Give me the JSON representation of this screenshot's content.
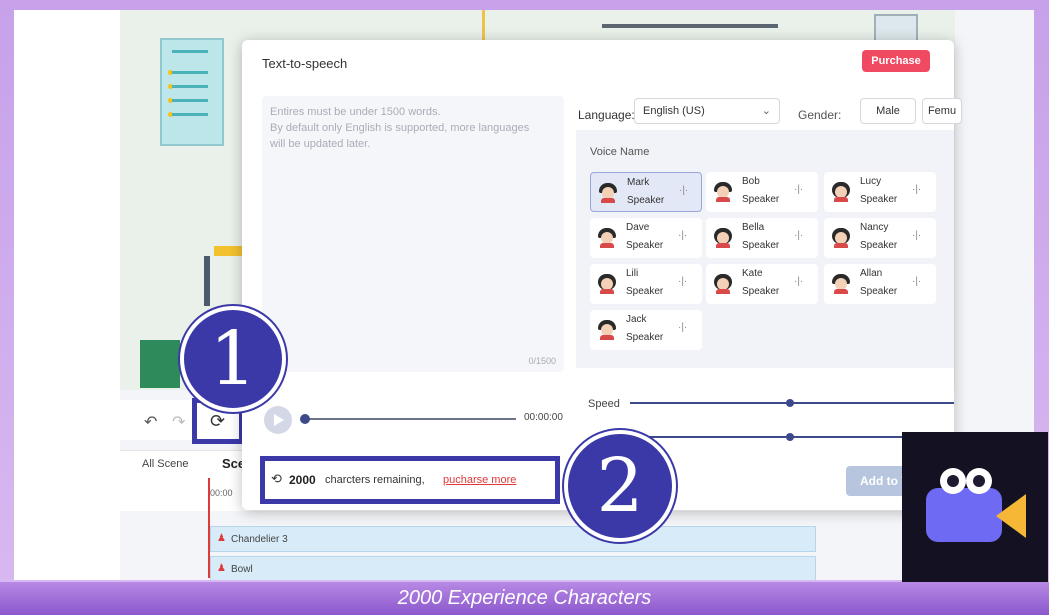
{
  "dialog": {
    "title": "Text-to-speech",
    "purchase_label": "Purchase",
    "textarea": {
      "line1": "Entires must be under 1500 words.",
      "line2": "By default only English is supported, more languages",
      "line3": "will be updated later.",
      "char_count": "0/1500"
    },
    "language": {
      "label": "Language:",
      "selected": "English (US)"
    },
    "gender": {
      "label": "Gender:",
      "options": [
        "Male",
        "Femu"
      ]
    },
    "voice_header": "Voice Name",
    "voices": [
      {
        "name": "Mark",
        "role": "Speaker",
        "selected": true
      },
      {
        "name": "Bob",
        "role": "Speaker",
        "selected": false
      },
      {
        "name": "Lucy",
        "role": "Speaker",
        "selected": false
      },
      {
        "name": "Dave",
        "role": "Speaker",
        "selected": false
      },
      {
        "name": "Bella",
        "role": "Speaker",
        "selected": false
      },
      {
        "name": "Nancy",
        "role": "Speaker",
        "selected": false
      },
      {
        "name": "Lili",
        "role": "Speaker",
        "selected": false
      },
      {
        "name": "Kate",
        "role": "Speaker",
        "selected": false
      },
      {
        "name": "Allan",
        "role": "Speaker",
        "selected": false
      },
      {
        "name": "Jack",
        "role": "Speaker",
        "selected": false
      }
    ],
    "audio_time": "00:00:00",
    "speed_label": "Speed",
    "remaining": {
      "count": "2000",
      "text": "charcters remaining,",
      "link": "pucharse more"
    },
    "add_button": "Add to T"
  },
  "editor": {
    "all_scene": "All Scene",
    "scene_tab": "Sce",
    "time_zero": "00:00",
    "tracks": [
      "Chandelier 3",
      "Bowl"
    ]
  },
  "callouts": [
    "1",
    "2"
  ],
  "caption": "2000 Experience Characters",
  "colors": {
    "callout": "#3b39a8",
    "purchase": "#f04a63",
    "link": "#e0393a",
    "logo_bg": "#141222"
  }
}
